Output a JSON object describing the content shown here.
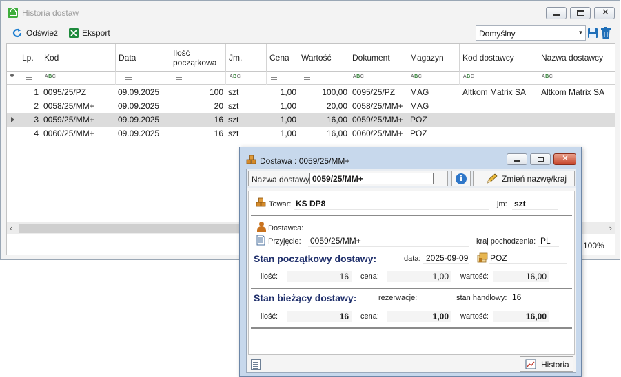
{
  "main": {
    "title": "Historia dostaw",
    "toolbar": {
      "refresh_label": "Odśwież",
      "export_label": "Eksport"
    },
    "layout_select": {
      "value": "Domyślny"
    },
    "columns": [
      "Lp.",
      "Kod",
      "Data",
      "Ilość początkowa",
      "Jm.",
      "Cena",
      "Wartość",
      "Dokument",
      "Magazyn",
      "Kod dostawcy",
      "Nazwa dostawcy"
    ],
    "rows": [
      {
        "lp": "1",
        "kod": "0095/25/PZ",
        "data": "09.09.2025",
        "ilosc": "100",
        "jm": "szt",
        "cena": "1,00",
        "wartosc": "100,00",
        "dokument": "0095/25/PZ",
        "magazyn": "MAG",
        "kod_dostawcy": "Altkom Matrix SA",
        "nazwa_dostawcy": "Altkom Matrix SA"
      },
      {
        "lp": "2",
        "kod": "0058/25/MM+",
        "data": "09.09.2025",
        "ilosc": "20",
        "jm": "szt",
        "cena": "1,00",
        "wartosc": "20,00",
        "dokument": "0058/25/MM+",
        "magazyn": "MAG",
        "kod_dostawcy": "",
        "nazwa_dostawcy": ""
      },
      {
        "lp": "3",
        "kod": "0059/25/MM+",
        "data": "09.09.2025",
        "ilosc": "16",
        "jm": "szt",
        "cena": "1,00",
        "wartosc": "16,00",
        "dokument": "0059/25/MM+",
        "magazyn": "POZ",
        "kod_dostawcy": "",
        "nazwa_dostawcy": ""
      },
      {
        "lp": "4",
        "kod": "0060/25/MM+",
        "data": "09.09.2025",
        "ilosc": "16",
        "jm": "szt",
        "cena": "1,00",
        "wartosc": "16,00",
        "dokument": "0060/25/MM+",
        "magazyn": "POZ",
        "kod_dostawcy": "",
        "nazwa_dostawcy": ""
      }
    ],
    "selected_row": 3,
    "zoom": "100%"
  },
  "dialog": {
    "title": "Dostawa : 0059/25/MM+",
    "name_label": "Nazwa dostawy:",
    "name_value": "0059/25/MM+",
    "rename_label": "Zmień nazwę/kraj",
    "towar_label": "Towar:",
    "towar_value": "KS DP8",
    "jm_label": "jm:",
    "jm_value": "szt",
    "dostawca_label": "Dostawca:",
    "dostawca_value": "",
    "przyjecie_label": "Przyjęcie:",
    "przyjecie_value": "0059/25/MM+",
    "kraj_label": "kraj pochodzenia:",
    "kraj_value": "PL",
    "initial": {
      "title": "Stan początkowy dostawy:",
      "data_label": "data:",
      "data_value": "2025-09-09",
      "warehouse": "POZ",
      "ilosc_label": "ilość:",
      "ilosc_value": "16",
      "cena_label": "cena:",
      "cena_value": "1,00",
      "wartosc_label": "wartość:",
      "wartosc_value": "16,00"
    },
    "current": {
      "title": "Stan bieżący dostawy:",
      "rezerwacje_label": "rezerwacje:",
      "rezerwacje_value": "",
      "stan_label": "stan handlowy:",
      "stan_value": "16",
      "ilosc_label": "ilość:",
      "ilosc_value": "16",
      "cena_label": "cena:",
      "cena_value": "1,00",
      "wartosc_label": "wartość:",
      "wartosc_value": "16,00"
    },
    "history_label": "Historia"
  },
  "colors": {
    "accent": "#1f2f6b",
    "selected_row": "#dcdcdc",
    "dialog_frame": "#c7d8ec"
  }
}
